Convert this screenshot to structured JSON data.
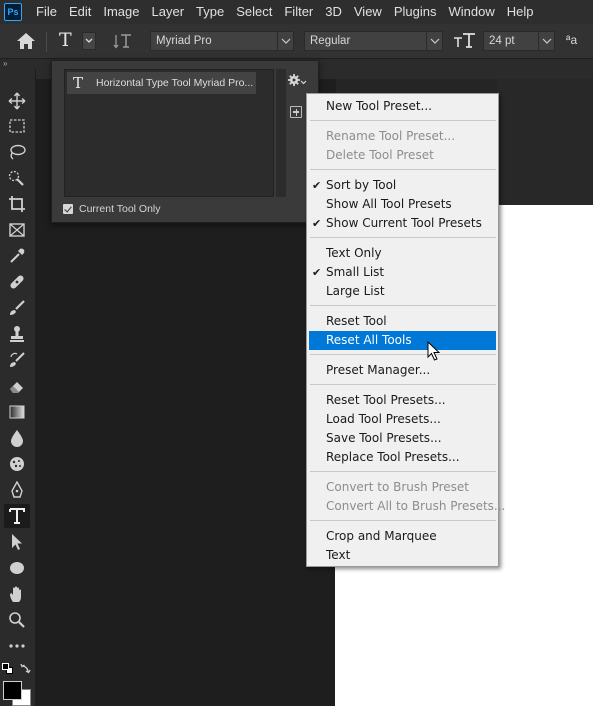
{
  "app": {
    "logo": "Ps"
  },
  "menubar": {
    "items": [
      "File",
      "Edit",
      "Image",
      "Layer",
      "Type",
      "Select",
      "Filter",
      "3D",
      "View",
      "Plugins",
      "Window",
      "Help"
    ]
  },
  "options_bar": {
    "tool_glyph": "T",
    "font_family": "Myriad Pro",
    "font_style": "Regular",
    "font_size": "24 pt",
    "antialias_glyph": "ªa"
  },
  "toolbar": {
    "collapse_glyph": "»",
    "tools": [
      "move-icon",
      "marquee-icon",
      "lasso-icon",
      "quick-select-icon",
      "crop-icon",
      "frame-icon",
      "eyedropper-icon",
      "healing-icon",
      "brush-icon",
      "stamp-icon",
      "history-brush-icon",
      "eraser-icon",
      "gradient-icon",
      "blur-icon",
      "sponge-icon",
      "pen-icon",
      "type-icon",
      "path-select-icon",
      "ellipse-icon",
      "hand-icon",
      "zoom-icon",
      "more-tools-icon"
    ],
    "active_tool": "type-icon"
  },
  "preset_panel": {
    "preset_icon": "T",
    "preset_label": "Horizontal Type Tool Myriad Pro...",
    "current_tool_only_label": "Current Tool Only",
    "current_tool_only_checked": true
  },
  "context_menu": {
    "items": [
      {
        "label": "New Tool Preset...",
        "state": "normal"
      },
      {
        "label": "Rename Tool Preset...",
        "state": "disabled"
      },
      {
        "label": "Delete Tool Preset",
        "state": "disabled"
      },
      {
        "label": "Sort by Tool",
        "state": "checked"
      },
      {
        "label": "Show All Tool Presets",
        "state": "normal"
      },
      {
        "label": "Show Current Tool Presets",
        "state": "checked"
      },
      {
        "label": "Text Only",
        "state": "normal"
      },
      {
        "label": "Small List",
        "state": "checked"
      },
      {
        "label": "Large List",
        "state": "normal"
      },
      {
        "label": "Reset Tool",
        "state": "normal"
      },
      {
        "label": "Reset All Tools",
        "state": "highlighted"
      },
      {
        "label": "Preset Manager...",
        "state": "normal"
      },
      {
        "label": "Reset Tool Presets...",
        "state": "normal"
      },
      {
        "label": "Load Tool Presets...",
        "state": "normal"
      },
      {
        "label": "Save Tool Presets...",
        "state": "normal"
      },
      {
        "label": "Replace Tool Presets...",
        "state": "normal"
      },
      {
        "label": "Convert to Brush Preset",
        "state": "disabled"
      },
      {
        "label": "Convert All to Brush Presets...",
        "state": "disabled"
      },
      {
        "label": "Crop and Marquee",
        "state": "normal"
      },
      {
        "label": "Text",
        "state": "normal"
      }
    ],
    "check_glyph": "✔"
  },
  "colors": {
    "highlight": "#0078d7",
    "menu_bg": "#f0f0f0",
    "ui_dark": "#2b2b2b",
    "ps_blue": "#31a8ff"
  }
}
